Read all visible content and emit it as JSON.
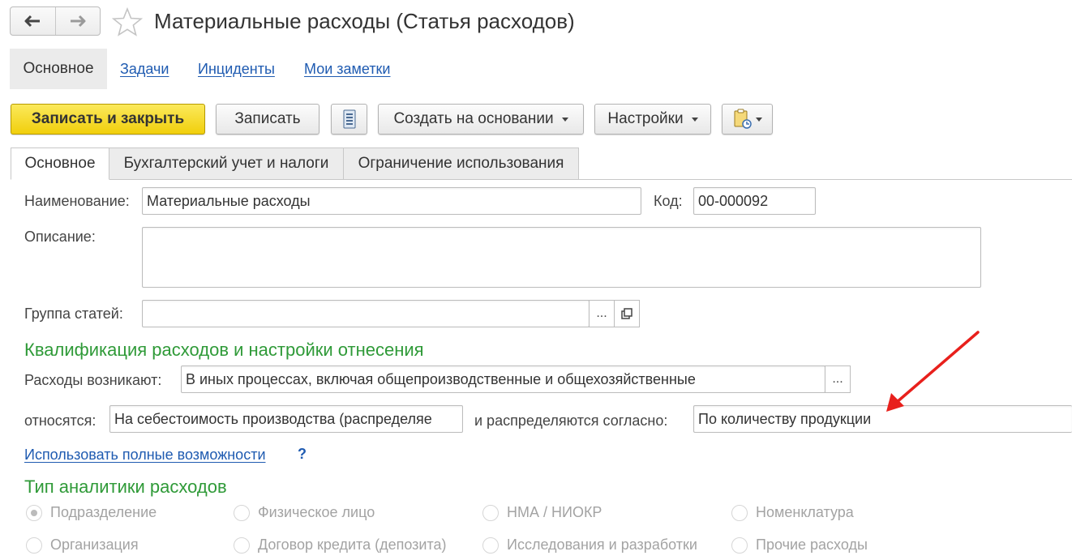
{
  "header": {
    "title": "Материальные расходы (Статья расходов)"
  },
  "top_tabs": [
    {
      "label": "Основное"
    },
    {
      "label": "Задачи"
    },
    {
      "label": "Инциденты"
    },
    {
      "label": "Мои заметки"
    }
  ],
  "toolbar": {
    "save_close": "Записать и закрыть",
    "save": "Записать",
    "create_based": "Создать на основании",
    "settings": "Настройки"
  },
  "form_tabs": [
    {
      "label": "Основное"
    },
    {
      "label": "Бухгалтерский учет и налоги"
    },
    {
      "label": "Ограничение использования"
    }
  ],
  "form": {
    "name_label": "Наименование:",
    "name_value": "Материальные расходы",
    "code_label": "Код:",
    "code_value": "00-000092",
    "description_label": "Описание:",
    "description_value": "",
    "group_label": "Группа статей:",
    "group_value": "",
    "qual_title": "Квалификация расходов и настройки отнесения",
    "arise_label": "Расходы возникают:",
    "arise_value": "В иных процессах, включая общепроизводственные и общехозяйственные",
    "relate_label": "относятся:",
    "relate_value": "На себестоимость производства (распределяе",
    "distrib_label": "и распределяются согласно:",
    "distrib_value": "По количеству продукции",
    "full_link": "Использовать полные возможности",
    "help": "?",
    "analytics_title": "Тип аналитики расходов",
    "options": [
      "Подразделение",
      "Физическое лицо",
      "НМА / НИОКР",
      "Номенклатура",
      "Организация",
      "Договор кредита (депозита)",
      "Исследования и разработки",
      "Прочие расходы"
    ],
    "selected_option": "Подразделение"
  },
  "colors": {
    "accent_green": "#2f9a38",
    "link_blue": "#1f5bb1",
    "primary_yellow": "#f1cf0c",
    "annotation_red": "#e8201c"
  }
}
